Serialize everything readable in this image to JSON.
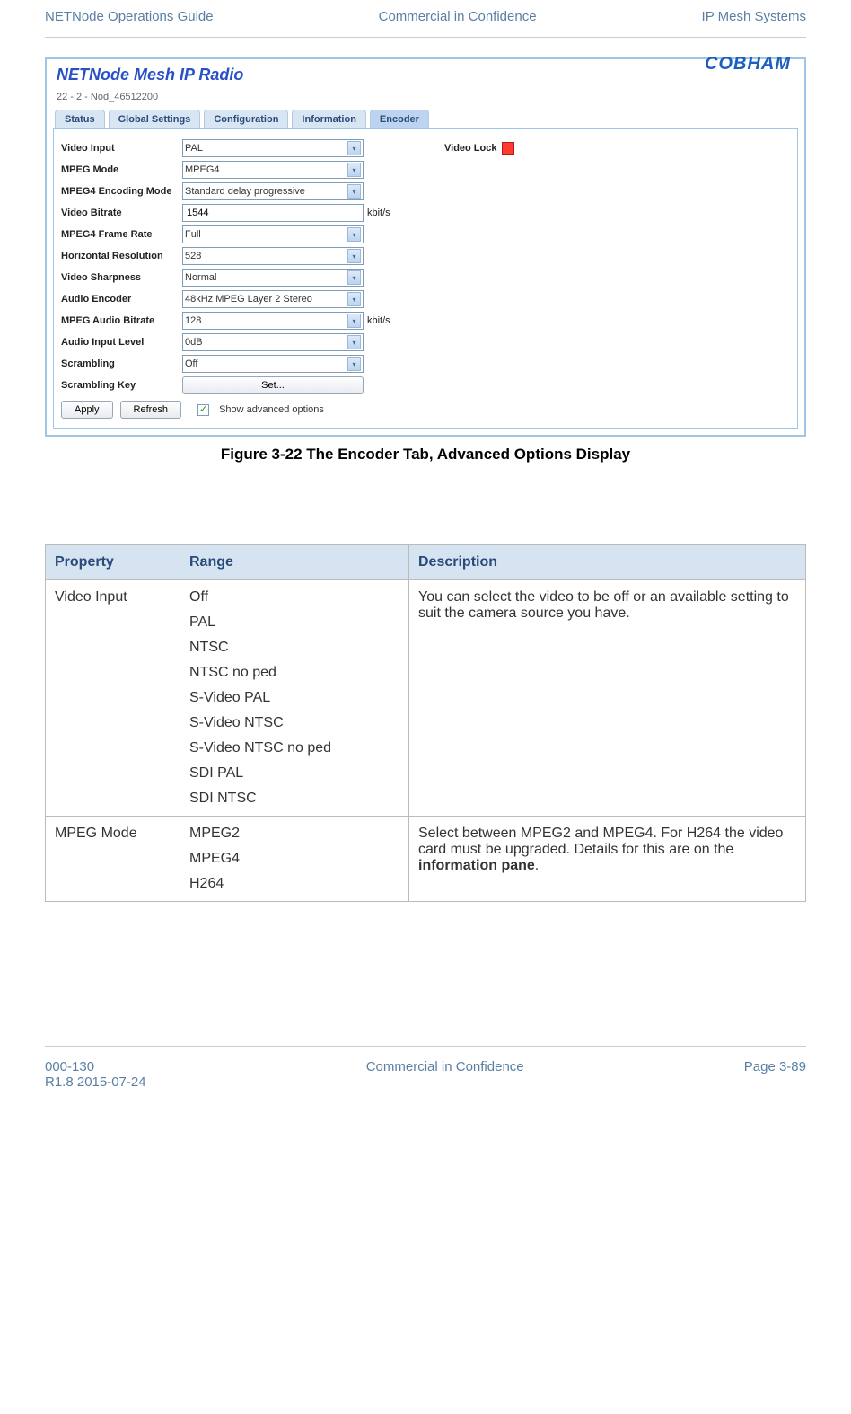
{
  "header": {
    "left": "NETNode Operations Guide",
    "center": "Commercial in Confidence",
    "right": "IP Mesh Systems"
  },
  "footer": {
    "left_line1": "000-130",
    "left_line2": "R1.8 2015-07-24",
    "center": "Commercial in Confidence",
    "right": "Page 3-89"
  },
  "screenshot": {
    "title": "NETNode Mesh IP Radio",
    "subtitle": "22 - 2 - Nod_46512200",
    "logo_text": "COBHAM",
    "tabs": [
      {
        "label": "Status",
        "active": false
      },
      {
        "label": "Global Settings",
        "active": false
      },
      {
        "label": "Configuration",
        "active": false
      },
      {
        "label": "Information",
        "active": false
      },
      {
        "label": "Encoder",
        "active": true
      }
    ],
    "form": {
      "video_input": {
        "label": "Video Input",
        "value": "PAL"
      },
      "mpeg_mode": {
        "label": "MPEG Mode",
        "value": "MPEG4"
      },
      "mpeg4_enc_mode": {
        "label": "MPEG4 Encoding Mode",
        "value": "Standard delay progressive"
      },
      "video_bitrate": {
        "label": "Video Bitrate",
        "value": "1544",
        "unit": "kbit/s"
      },
      "mpeg4_frame_rate": {
        "label": "MPEG4 Frame Rate",
        "value": "Full"
      },
      "horiz_res": {
        "label": "Horizontal Resolution",
        "value": "528"
      },
      "video_sharpness": {
        "label": "Video Sharpness",
        "value": "Normal"
      },
      "audio_encoder": {
        "label": "Audio Encoder",
        "value": "48kHz MPEG Layer 2 Stereo"
      },
      "mpeg_audio_bitrate": {
        "label": "MPEG Audio Bitrate",
        "value": "128",
        "unit": "kbit/s"
      },
      "audio_input_level": {
        "label": "Audio Input Level",
        "value": "0dB"
      },
      "scrambling": {
        "label": "Scrambling",
        "value": "Off"
      },
      "scrambling_key": {
        "label": "Scrambling Key",
        "button_label": "Set..."
      },
      "video_lock_label": "Video Lock",
      "apply_label": "Apply",
      "refresh_label": "Refresh",
      "advanced_label": "Show advanced options"
    }
  },
  "figure_caption": "Figure 3-22 The Encoder Tab, Advanced Options Display",
  "table": {
    "headers": {
      "c1": "Property",
      "c2": "Range",
      "c3": "Description"
    },
    "rows": [
      {
        "property": "Video Input",
        "range": [
          "Off",
          "PAL",
          "NTSC",
          "NTSC no ped",
          "S-Video PAL",
          "S-Video NTSC",
          "S-Video NTSC no ped",
          "SDI PAL",
          "SDI NTSC"
        ],
        "desc_pre": "You can select the video to be off or an available setting to suit the camera source you have.",
        "desc_bold": "",
        "desc_post": ""
      },
      {
        "property": "MPEG Mode",
        "range": [
          "MPEG2",
          "MPEG4",
          "H264"
        ],
        "desc_pre": "Select between MPEG2 and MPEG4. For H264 the video card must be upgraded. Details for this are on the ",
        "desc_bold": "information pane",
        "desc_post": "."
      }
    ]
  }
}
